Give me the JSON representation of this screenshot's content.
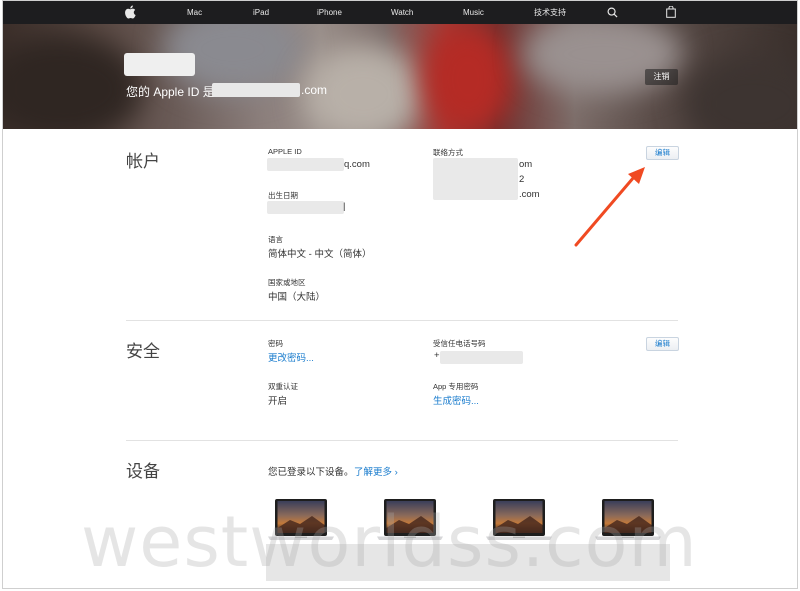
{
  "nav": {
    "items": [
      "Mac",
      "iPad",
      "iPhone",
      "Watch",
      "Music",
      "技术支持"
    ],
    "icons": [
      "apple-logo",
      "search-icon",
      "bag-icon"
    ]
  },
  "hero": {
    "greeting_prefix": "您的 Apple ID 是",
    "greeting_suffix": ".com",
    "logout_label": "注销"
  },
  "account": {
    "title": "帐户",
    "apple_id_label": "APPLE ID",
    "apple_id_suffix": "q.com",
    "birthday_label": "出生日期",
    "birthday_suffix": "|",
    "language_label": "语言",
    "language_value": "简体中文 - 中文（简体）",
    "region_label": "国家或地区",
    "region_value": "中国（大陆）",
    "contact_label": "联络方式",
    "contact_lines": [
      "om",
      "2",
      ".com"
    ],
    "edit_label": "编辑"
  },
  "security": {
    "title": "安全",
    "password_label": "密码",
    "password_link": "更改密码...",
    "trusted_phone_label": "受信任电话号码",
    "trusted_phone_prefix": "+",
    "two_factor_label": "双重认证",
    "two_factor_value": "开启",
    "app_password_label": "App 专用密码",
    "app_password_link": "生成密码...",
    "edit_label": "编辑"
  },
  "devices": {
    "title": "设备",
    "intro": "您已登录以下设备。",
    "learn_more": "了解更多 ›",
    "count": 4
  },
  "annotation": {
    "arrow_color": "#f04a22"
  },
  "watermark": "westworldss.com"
}
